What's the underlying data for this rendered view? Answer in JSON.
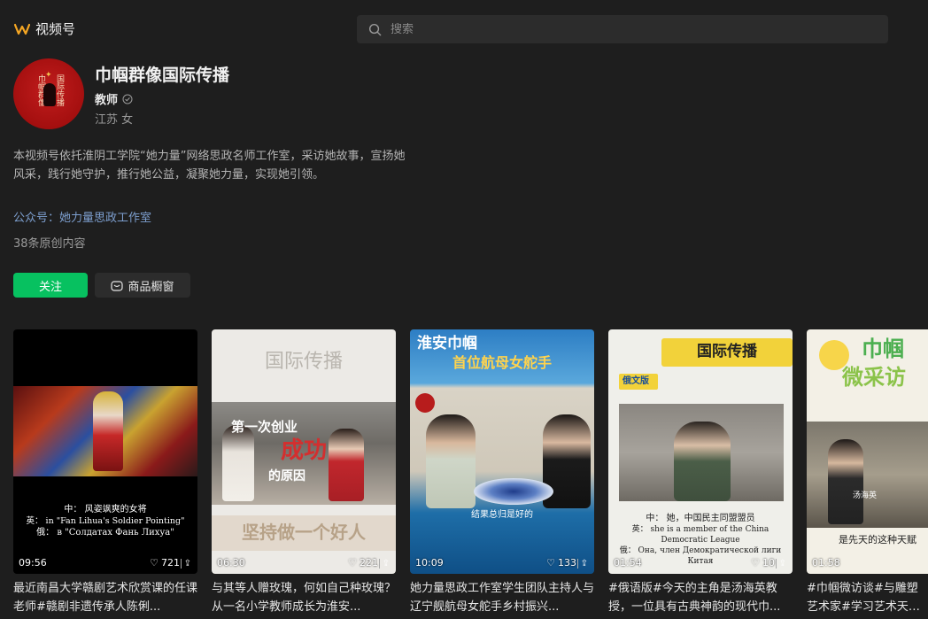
{
  "header": {
    "brand": "视频号",
    "search_placeholder": "搜索"
  },
  "profile": {
    "name": "巾帼群像国际传播",
    "role": "教师",
    "location": "江苏 女",
    "avatar_text_1": "巾帼群像",
    "avatar_text_2": "国际传播",
    "bio": "本视频号依托淮阴工学院“她力量”网络思政名师工作室，采访她故事，宣扬她风采，践行她守护，推行她公益，凝聚她力量，实现她引领。",
    "official_account": "公众号：她力量思政工作室",
    "content_count": "38条原创内容"
  },
  "actions": {
    "follow_label": "关注",
    "shop_label": "商品橱窗"
  },
  "videos": [
    {
      "duration": "09:56",
      "likes": "721",
      "description": "最近南昌大学赣剧艺术欣赏课的任课老师#赣剧非遗传承人陈俐...",
      "overlay_1": "中： 风姿飒爽的女将",
      "overlay_2": "英： in \"Fan Lihua's Soldier Pointing\"",
      "overlay_3": "俄： в \"Солдатах Фань Лихуа\""
    },
    {
      "duration": "06:30",
      "likes": "221",
      "description": "与其等人赠玫瑰，何如自己种玫瑰？从一名小学教师成长为淮安...",
      "overlay_1": "国际传播",
      "overlay_2": "第一次创业",
      "overlay_3": "成功",
      "overlay_4": "的原因",
      "overlay_5": "坚持做一个好人"
    },
    {
      "duration": "10:09",
      "likes": "133",
      "description": "她力量思政工作室学生团队主持人与辽宁舰航母女舵手乡村振兴...",
      "overlay_1": "淮安巾帼",
      "overlay_2": "首位航母女舵手",
      "overlay_3": "结果总归是好的"
    },
    {
      "duration": "01:54",
      "likes": "10",
      "description": "#俄语版#今天的主角是汤海英教授，一位具有古典神韵的现代巾...",
      "overlay_1": "国际传播",
      "overlay_2": "俄文版",
      "overlay_3": "中： 她，中国民主同盟盟员",
      "overlay_4": "英： she is a member of the China Democratic League",
      "overlay_5": "俄： Она, член Демократической лиги Китая"
    },
    {
      "duration": "01:58",
      "likes": "",
      "description": "#巾帼微访谈#与雕塑艺术家#学习艺术天赋与努力",
      "overlay_1": "巾帼",
      "overlay_2": "微采访",
      "overlay_3": "是先天的这种天赋",
      "overlay_4": "汤海英"
    }
  ],
  "colors": {
    "background": "#1e1e1e",
    "accent_green": "#07c160",
    "link_blue": "#7d9fcf",
    "brand_orange": "#f5a623"
  }
}
